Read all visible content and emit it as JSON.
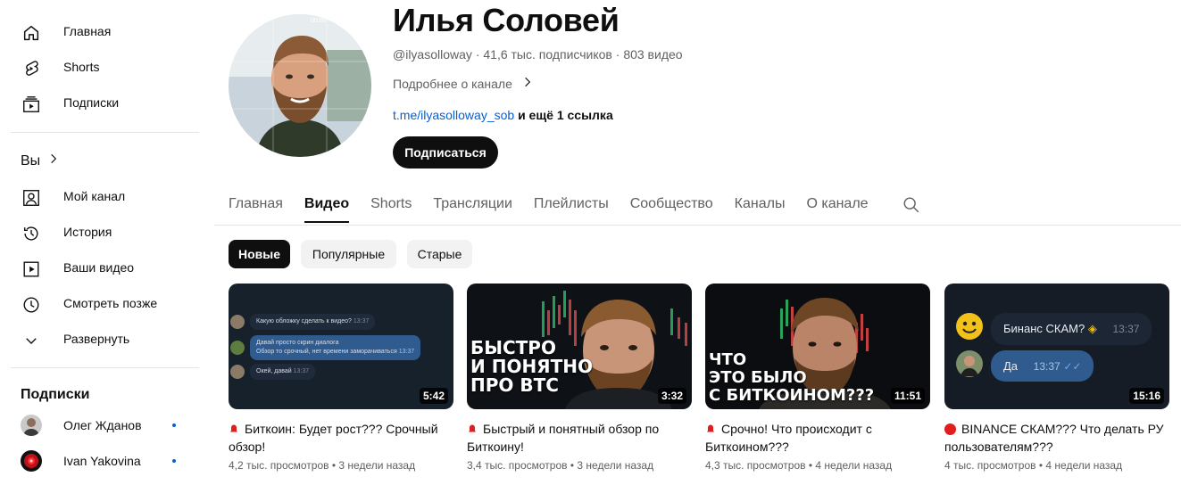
{
  "sidebar": {
    "items": [
      {
        "label": "Главная",
        "icon": "home-icon"
      },
      {
        "label": "Shorts",
        "icon": "shorts-icon"
      },
      {
        "label": "Подписки",
        "icon": "subscriptions-icon"
      }
    ],
    "you_header": "Вы",
    "you_items": [
      {
        "label": "Мой канал",
        "icon": "your-channel-icon"
      },
      {
        "label": "История",
        "icon": "history-icon"
      },
      {
        "label": "Ваши видео",
        "icon": "your-videos-icon"
      },
      {
        "label": "Смотреть позже",
        "icon": "watch-later-icon"
      },
      {
        "label": "Развернуть",
        "icon": "chevron-down-icon"
      }
    ],
    "subs_header": "Подписки",
    "subscriptions": [
      {
        "label": "Олег Жданов"
      },
      {
        "label": "Ivan Yakovina"
      }
    ]
  },
  "channel": {
    "name": "Илья Соловей",
    "handle": "@ilyasolloway",
    "subscribers": "41,6 тыс. подписчиков",
    "video_count": "803 видео",
    "more_about": "Подробнее о канале",
    "link": "t.me/ilyasolloway_sob",
    "more_links": "и ещё 1 ссылка",
    "subscribe_label": "Подписаться",
    "avatar_time": "00:00"
  },
  "tabs": [
    "Главная",
    "Видео",
    "Shorts",
    "Трансляции",
    "Плейлисты",
    "Сообщество",
    "Каналы",
    "О канале"
  ],
  "active_tab": "Видео",
  "chips": [
    "Новые",
    "Популярные",
    "Старые"
  ],
  "videos": [
    {
      "title": "Биткоин: Будет рост??? Срочный обзор!",
      "duration": "5:42",
      "views": "4,2 тыс. просмотров",
      "age": "3 недели назад",
      "thumb_chat": [
        "Какую обложку сделать к видео?",
        "Давай просто скрин диалога",
        "Обзор то срочный, нет времени заморачиваться",
        "Окей, давай"
      ],
      "thumb_times": [
        "13:37",
        "13:37",
        "13:37"
      ]
    },
    {
      "title": "Быстрый и понятный обзор по Биткоину!",
      "duration": "3:32",
      "views": "3,4 тыс. просмотров",
      "age": "3 недели назад",
      "thumb_text": [
        "БЫСТРО",
        "И ПОНЯТНО",
        "ПРО BTC"
      ]
    },
    {
      "title": "Срочно! Что происходит с Биткоином???",
      "duration": "11:51",
      "views": "4,3 тыс. просмотров",
      "age": "4 недели назад",
      "thumb_text": [
        "ЧТО",
        "ЭТО БЫЛО",
        "С БИТКОИНОМ???"
      ]
    },
    {
      "title": "BINANCE СКАМ??? Что делать РУ пользователям???",
      "duration": "15:16",
      "views": "4 тыс. просмотров",
      "age": "4 недели назад",
      "thumb_chat": [
        "Бинанс СКАМ?",
        "Да"
      ],
      "thumb_times": [
        "13:37",
        "13:37"
      ]
    }
  ],
  "colors": {
    "accent": "#065fd4",
    "text": "#0f0f0f",
    "secondary": "#606060",
    "live_red": "#e21d1d"
  }
}
